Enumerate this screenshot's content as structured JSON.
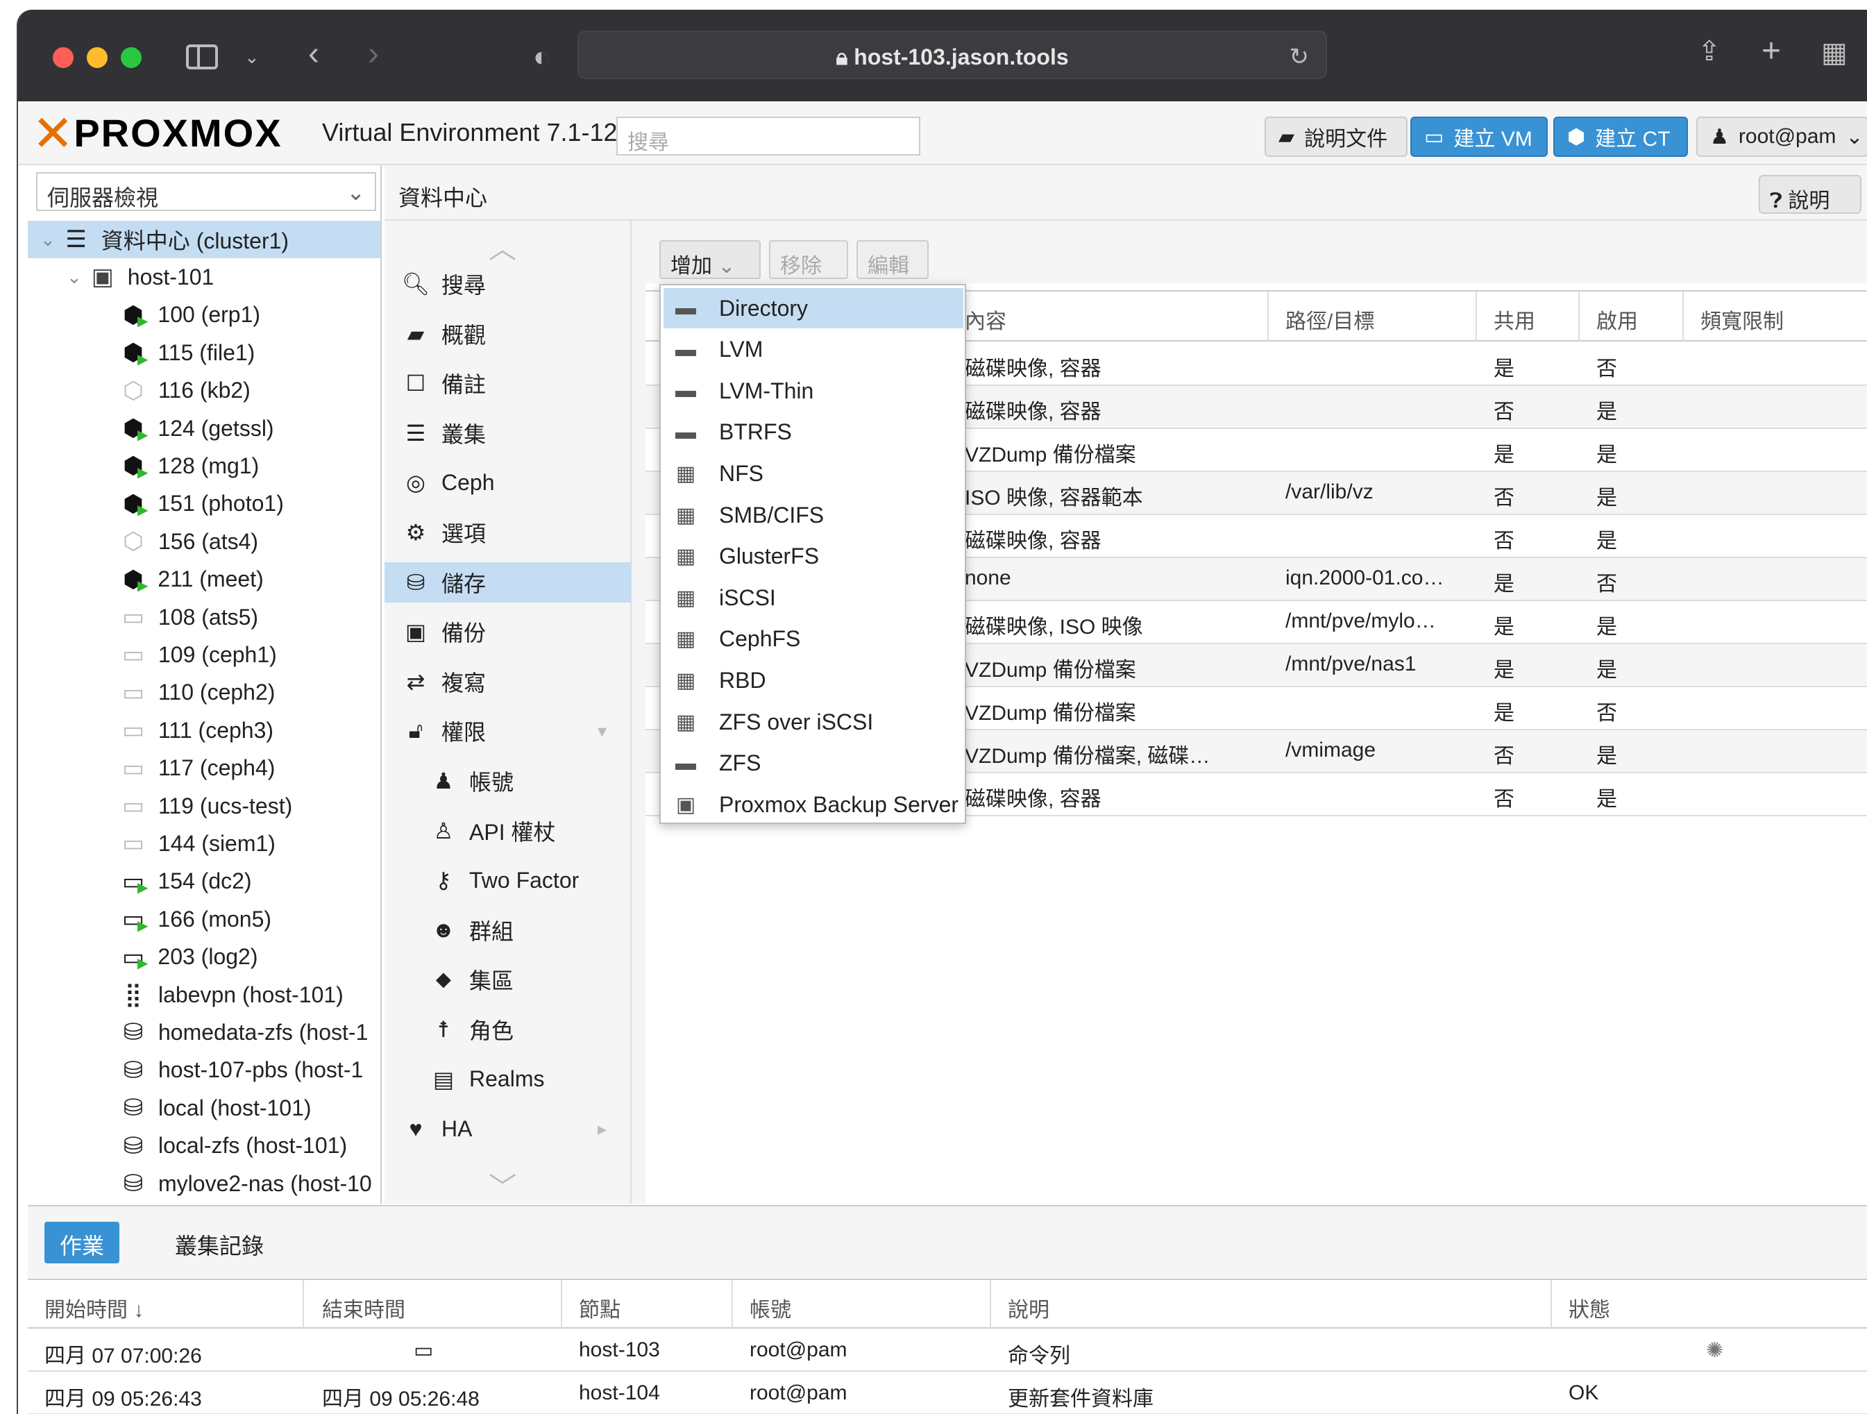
{
  "browser": {
    "url": "host-103.jason.tools"
  },
  "header": {
    "logo_text": "PROXMOX",
    "version": "Virtual Environment 7.1-12",
    "search_placeholder": "搜尋",
    "docs_label": "說明文件",
    "create_vm_label": "建立 VM",
    "create_ct_label": "建立 CT",
    "user_label": "root@pam"
  },
  "tree": {
    "view_selector": "伺服器檢視",
    "items": [
      {
        "label": "資料中心 (cluster1)",
        "icon": "datacenter-icon"
      },
      {
        "label": "host-101",
        "icon": "node-online-icon"
      },
      {
        "label": "100 (erp1)",
        "icon": "ct-running-icon"
      },
      {
        "label": "115 (file1)",
        "icon": "ct-running-icon"
      },
      {
        "label": "116 (kb2)",
        "icon": "ct-stopped-icon"
      },
      {
        "label": "124 (getssl)",
        "icon": "ct-running-icon"
      },
      {
        "label": "128 (mg1)",
        "icon": "ct-running-icon"
      },
      {
        "label": "151 (photo1)",
        "icon": "ct-running-icon"
      },
      {
        "label": "156 (ats4)",
        "icon": "ct-stopped-icon"
      },
      {
        "label": "211 (meet)",
        "icon": "ct-running-icon"
      },
      {
        "label": "108 (ats5)",
        "icon": "vm-stopped-icon"
      },
      {
        "label": "109 (ceph1)",
        "icon": "vm-stopped-icon"
      },
      {
        "label": "110 (ceph2)",
        "icon": "vm-stopped-icon"
      },
      {
        "label": "111 (ceph3)",
        "icon": "vm-stopped-icon"
      },
      {
        "label": "117 (ceph4)",
        "icon": "vm-stopped-icon"
      },
      {
        "label": "119 (ucs-test)",
        "icon": "vm-stopped-icon"
      },
      {
        "label": "144 (siem1)",
        "icon": "vm-stopped-icon"
      },
      {
        "label": "154 (dc2)",
        "icon": "vm-running-icon"
      },
      {
        "label": "166 (mon5)",
        "icon": "vm-running-icon"
      },
      {
        "label": "203 (log2)",
        "icon": "vm-running-icon"
      },
      {
        "label": "labevpn (host-101)",
        "icon": "sdn-icon"
      },
      {
        "label": "homedata-zfs (host-1",
        "icon": "storage-icon"
      },
      {
        "label": "host-107-pbs (host-1",
        "icon": "storage-icon"
      },
      {
        "label": "local (host-101)",
        "icon": "storage-icon"
      },
      {
        "label": "local-zfs (host-101)",
        "icon": "storage-icon"
      },
      {
        "label": "mylove2-nas (host-10",
        "icon": "storage-icon"
      }
    ]
  },
  "content": {
    "title": "資料中心",
    "help_label": "說明",
    "menu": [
      {
        "label": "搜尋",
        "icon": "search-icon"
      },
      {
        "label": "概觀",
        "icon": "book-icon"
      },
      {
        "label": "備註",
        "icon": "note-icon"
      },
      {
        "label": "叢集",
        "icon": "server-icon"
      },
      {
        "label": "Ceph",
        "icon": "ceph-icon"
      },
      {
        "label": "選項",
        "icon": "gear-icon"
      },
      {
        "label": "儲存",
        "icon": "database-icon"
      },
      {
        "label": "備份",
        "icon": "floppy-icon"
      },
      {
        "label": "複寫",
        "icon": "retweet-icon"
      },
      {
        "label": "權限",
        "icon": "unlock-icon"
      },
      {
        "label": "帳號",
        "icon": "user-icon"
      },
      {
        "label": "API 權杖",
        "icon": "user-outline-icon"
      },
      {
        "label": "Two Factor",
        "icon": "key-icon"
      },
      {
        "label": "群組",
        "icon": "users-icon"
      },
      {
        "label": "集區",
        "icon": "tags-icon"
      },
      {
        "label": "角色",
        "icon": "male-icon"
      },
      {
        "label": "Realms",
        "icon": "address-book-icon"
      },
      {
        "label": "HA",
        "icon": "heartbeat-icon"
      }
    ],
    "toolbar": {
      "add_label": "增加",
      "remove_label": "移除",
      "edit_label": "編輯"
    },
    "columns": {
      "content": "內容",
      "path": "路徑/目標",
      "shared": "共用",
      "enabled": "啟用",
      "bandwidth": "頻寬限制"
    },
    "rows": [
      {
        "content": "磁碟映像, 容器",
        "path": "",
        "shared": "是",
        "enabled": "否"
      },
      {
        "content": "磁碟映像, 容器",
        "path": "",
        "shared": "否",
        "enabled": "是"
      },
      {
        "content": "VZDump 備份檔案",
        "path": "",
        "shared": "是",
        "enabled": "是"
      },
      {
        "content": "ISO 映像, 容器範本",
        "path": "/var/lib/vz",
        "shared": "否",
        "enabled": "是"
      },
      {
        "content": "磁碟映像, 容器",
        "path": "",
        "shared": "否",
        "enabled": "是"
      },
      {
        "content": "none",
        "path": "iqn.2000-01.co…",
        "shared": "是",
        "enabled": "否"
      },
      {
        "content": "磁碟映像, ISO 映像",
        "path": "/mnt/pve/mylo…",
        "shared": "是",
        "enabled": "是"
      },
      {
        "content": "VZDump 備份檔案",
        "path": "/mnt/pve/nas1",
        "shared": "是",
        "enabled": "是"
      },
      {
        "content": "VZDump 備份檔案",
        "path": "",
        "shared": "是",
        "enabled": "否"
      },
      {
        "content": "VZDump 備份檔案, 磁碟…",
        "path": "/vmimage",
        "shared": "否",
        "enabled": "是"
      },
      {
        "content": "磁碟映像, 容器",
        "path": "",
        "shared": "否",
        "enabled": "是"
      }
    ],
    "add_menu": [
      {
        "label": "Directory",
        "icon": "folder-icon"
      },
      {
        "label": "LVM",
        "icon": "folder-icon"
      },
      {
        "label": "LVM-Thin",
        "icon": "folder-icon"
      },
      {
        "label": "BTRFS",
        "icon": "folder-icon"
      },
      {
        "label": "NFS",
        "icon": "building-icon"
      },
      {
        "label": "SMB/CIFS",
        "icon": "building-icon"
      },
      {
        "label": "GlusterFS",
        "icon": "building-icon"
      },
      {
        "label": "iSCSI",
        "icon": "building-icon"
      },
      {
        "label": "CephFS",
        "icon": "building-icon"
      },
      {
        "label": "RBD",
        "icon": "building-icon"
      },
      {
        "label": "ZFS over iSCSI",
        "icon": "building-icon"
      },
      {
        "label": "ZFS",
        "icon": "folder-icon"
      },
      {
        "label": "Proxmox Backup Server",
        "icon": "floppy-icon"
      }
    ]
  },
  "tasks": {
    "tab_tasks": "作業",
    "tab_cluster_log": "叢集記錄",
    "columns": {
      "start": "開始時間 ↓",
      "end": "結束時間",
      "node": "節點",
      "user": "帳號",
      "description": "說明",
      "status": "狀態"
    },
    "rows": [
      {
        "start": "四月 07 07:00:26",
        "end": "",
        "node": "host-103",
        "user": "root@pam",
        "description": "命令列",
        "status": ""
      },
      {
        "start": "四月 09 05:26:43",
        "end": "四月 09 05:26:48",
        "node": "host-104",
        "user": "root@pam",
        "description": "更新套件資料庫",
        "status": "OK"
      }
    ]
  }
}
